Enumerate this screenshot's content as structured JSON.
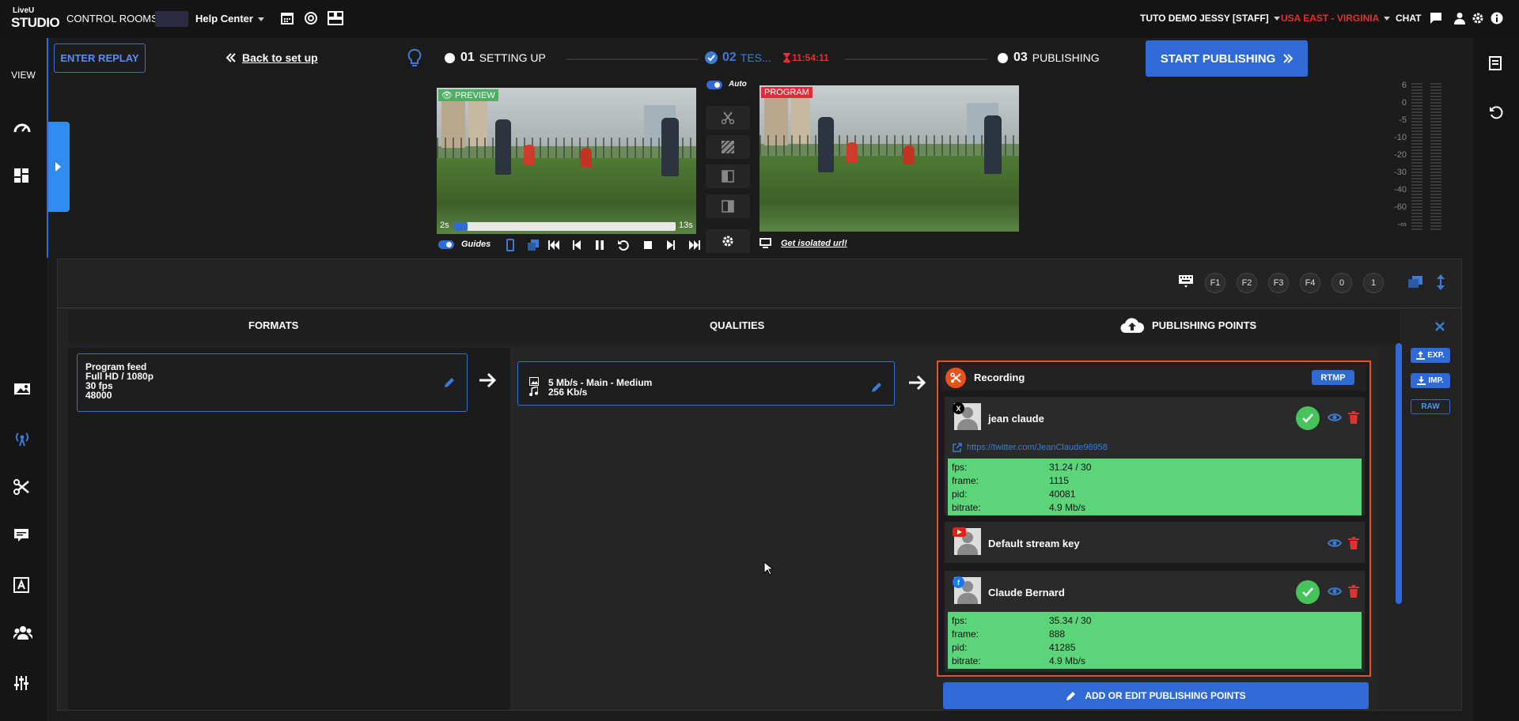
{
  "app": {
    "logo_top": "LiveU",
    "logo_bottom": "STUDIO",
    "control_rooms": "CONTROL ROOMS",
    "help_center": "Help Center",
    "user": "TUTO DEMO JESSY [STAFF]",
    "region": "USA EAST - VIRGINIA",
    "chat": "CHAT"
  },
  "sidebar": {
    "view_label": "VIEW"
  },
  "header": {
    "enter_replay": "ENTER REPLAY",
    "back": "Back to set up",
    "step1_num": "01",
    "step1_label": "SETTING UP",
    "step2_num": "02",
    "step2_label": "TES...",
    "timer": "11:54:11",
    "step3_num": "03",
    "step3_label": "PUBLISHING",
    "start_publishing": "START PUBLISHING"
  },
  "preview": {
    "label": "PREVIEW",
    "time_start": "2s",
    "time_end": "13s",
    "guides": "Guides",
    "progress": 0.06
  },
  "program": {
    "label": "PROGRAM",
    "isolated_url": "Get isolated url!"
  },
  "switcher": {
    "auto": "Auto"
  },
  "audio_meter": {
    "ticks": [
      "6",
      "0",
      "-5",
      "-10",
      "-20",
      "-30",
      "-40",
      "-60",
      "-∞"
    ]
  },
  "toolbar": {
    "keys": [
      "F1",
      "F2",
      "F3",
      "F4",
      "0",
      "1"
    ]
  },
  "columns": {
    "formats": "FORMATS",
    "qualities": "QUALITIES",
    "publishing_points": "PUBLISHING POINTS"
  },
  "format_card": {
    "line1": "Program feed",
    "line2": "Full HD / 1080p",
    "line3": "30 fps",
    "line4": "48000"
  },
  "quality_card": {
    "video": "5 Mb/s  -  Main  -  Medium",
    "audio": "256 Kb/s"
  },
  "recording": {
    "title": "Recording",
    "protocol": "RTMP"
  },
  "publishing_points": [
    {
      "name": "jean claude",
      "network": "X",
      "url": "https://twitter.com/JeanClaude96958",
      "stats": [
        {
          "k": "fps:",
          "v": "31.24 / 30"
        },
        {
          "k": "frame:",
          "v": "1115"
        },
        {
          "k": "pid:",
          "v": "40081"
        },
        {
          "k": "bitrate:",
          "v": "4.9 Mb/s"
        }
      ]
    },
    {
      "name": "Default stream key",
      "network": "YouTube"
    },
    {
      "name": "Claude Bernard",
      "network": "f",
      "stats": [
        {
          "k": "fps:",
          "v": "35.34 / 30"
        },
        {
          "k": "frame:",
          "v": "888"
        },
        {
          "k": "pid:",
          "v": "41285"
        },
        {
          "k": "bitrate:",
          "v": "4.9 Mb/s"
        }
      ]
    }
  ],
  "add_edit": "ADD OR EDIT PUBLISHING POINTS",
  "side_actions": {
    "export": "EXP.",
    "import": "IMP.",
    "raw": "RAW"
  },
  "colors": {
    "accent": "#2f6ad6",
    "success": "#5bd47a",
    "danger": "#e0322f",
    "recording": "#e8511b"
  }
}
